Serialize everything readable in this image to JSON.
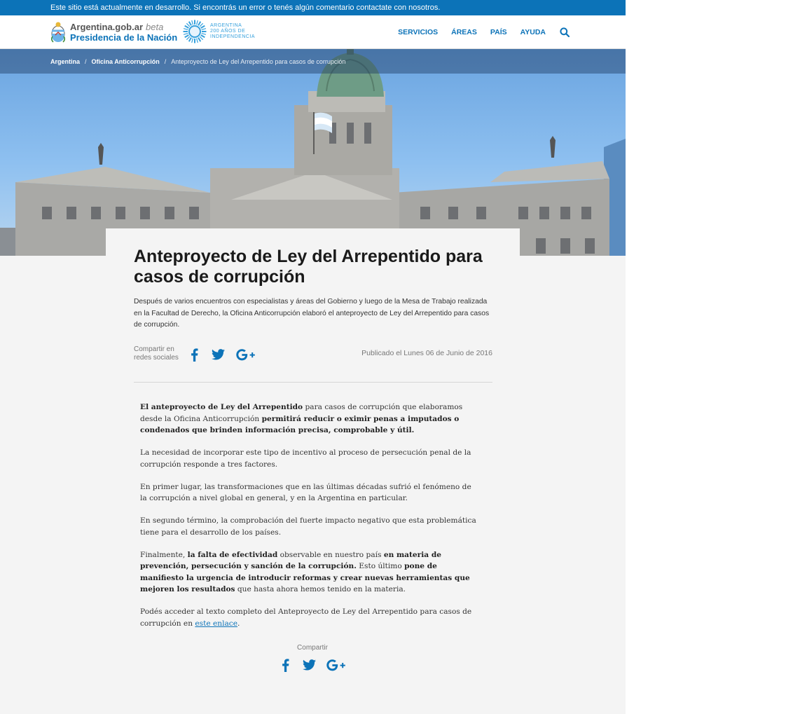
{
  "banner": {
    "text": "Este sitio está actualmente en desarrollo. Si encontrás un error o tenés algún comentario contactate con nosotros."
  },
  "header": {
    "logo_site": "Argentina.gob.ar",
    "logo_beta": "beta",
    "logo_org": "Presidencia de la Nación",
    "bicentenario_lines": [
      "ARGENTINA",
      "200 AÑOS DE",
      "INDEPENDENCIA"
    ],
    "nav": [
      "SERVICIOS",
      "ÁREAS",
      "PAÍS",
      "AYUDA"
    ],
    "search_icon": "search-icon"
  },
  "breadcrumb": {
    "items": [
      "Argentina",
      "Oficina Anticorrupción"
    ],
    "current": "Anteproyecto de Ley del Arrepentido para casos de corrupción"
  },
  "article": {
    "title": "Anteproyecto de Ley del Arrepentido para casos de corrupción",
    "lead": "Después de varios encuentros con especialistas y áreas del Gobierno y luego de la Mesa de Trabajo realizada en la Facultad de Derecho, la Oficina Anticorrupción elaboró el anteproyecto de Ley del Arrepentido para casos de corrupción.",
    "share_label": "Compartir en redes sociales",
    "published": "Publicado el Lunes 06 de Junio de 2016",
    "social_icons": [
      "facebook-icon",
      "twitter-icon",
      "google-plus-icon"
    ],
    "p1": {
      "b1": "El anteproyecto de Ley del Arrepentido",
      "t1": " para casos de corrupción que elaboramos desde la Oficina Anticorrupción ",
      "b2": "permitirá reducir o eximir penas a imputados o condenados que brinden información precisa, comprobable y útil."
    },
    "p2": "La necesidad de incorporar este tipo de incentivo al proceso de persecución penal de la corrupción responde a tres factores.",
    "p3": "En primer lugar, las transformaciones que en las últimas décadas sufrió el fenómeno de la corrupción a nivel global en general, y en la Argentina en particular.",
    "p4": "En segundo término, la comprobación del fuerte impacto negativo que esta problemática tiene para el desarrollo de los países.",
    "p5": {
      "t1": "Finalmente, ",
      "b1": "la falta de efectividad",
      "t2": " observable en nuestro país ",
      "b2": "en materia de prevención, persecución y sanción de la corrupción.",
      "t3": " Esto último ",
      "b3": "pone de manifiesto la urgencia de introducir reformas y crear nuevas herramientas que mejoren los resultados",
      "t4": " que hasta ahora hemos tenido en la materia."
    },
    "p6": {
      "t1": "Podés acceder al texto completo del Anteproyecto de Ley del Arrepentido para casos de corrupción en ",
      "link": "este enlace",
      "t2": "."
    },
    "bottom_share_label": "Compartir"
  },
  "colors": {
    "primary": "#0c73b8",
    "banner": "#0c73b8",
    "page_background": "#f4f4f4"
  }
}
